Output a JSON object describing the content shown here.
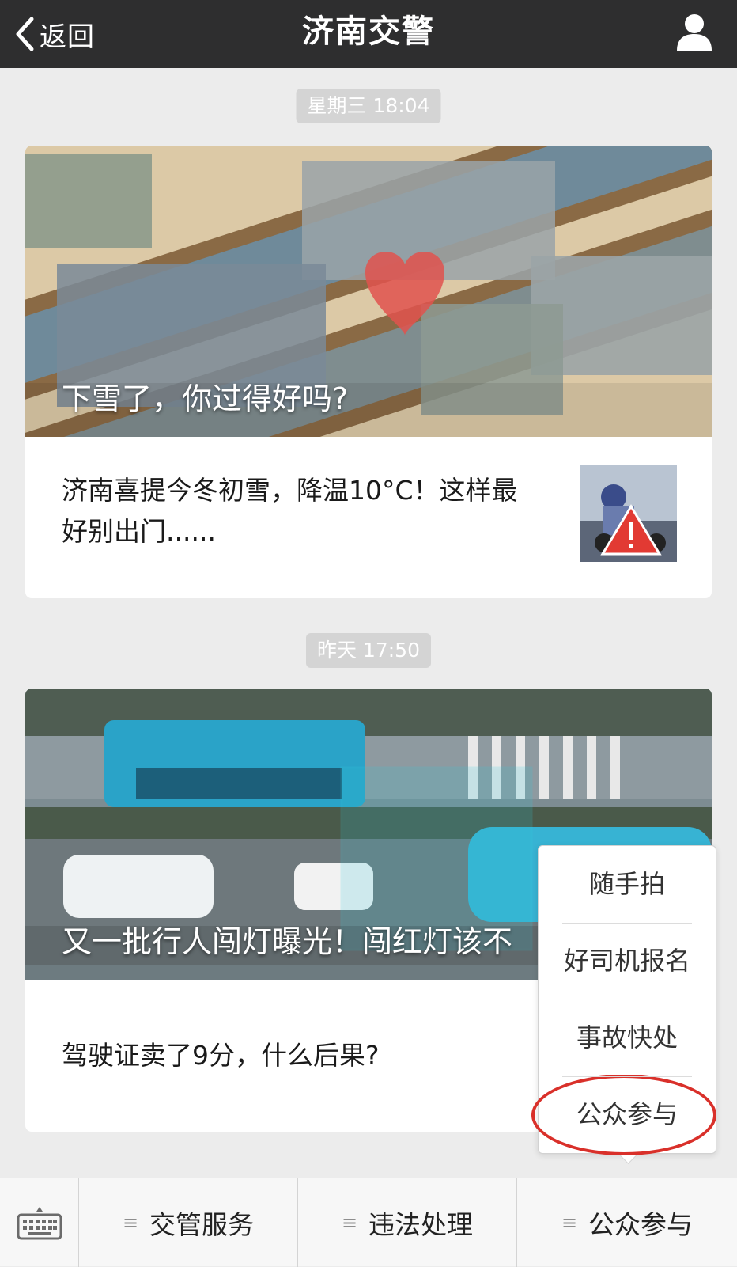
{
  "header": {
    "back_label": "返回",
    "title": "济南交警",
    "icons": {
      "back": "chevron-left-icon",
      "profile": "user-icon"
    }
  },
  "feed": [
    {
      "timestamp": "星期三 18:04",
      "cover_caption": "下雪了，你过得好吗?",
      "sub_title": "济南喜提今冬初雪，降温10°C！这样最好别出门......",
      "thumbnail": "snow-warning-thumbnail"
    },
    {
      "timestamp": "昨天 17:50",
      "cover_caption": "又一批行人闯灯曝光！闯红灯该不",
      "sub_title": "驾驶证卖了9分，什么后果?"
    }
  ],
  "popup_menu": {
    "items": [
      "随手拍",
      "好司机报名",
      "事故快处",
      "公众参与"
    ],
    "highlighted": "公众参与",
    "highlight_color": "#d9302a"
  },
  "bottom_bar": {
    "keyboard_icon": "keyboard-icon",
    "tabs": [
      {
        "label": "交管服务",
        "icon": "menu-icon"
      },
      {
        "label": "违法处理",
        "icon": "menu-icon"
      },
      {
        "label": "公众参与",
        "icon": "menu-icon"
      }
    ]
  },
  "colors": {
    "header_bg": "#2e2e2f",
    "page_bg": "#ececec",
    "timestamp_bg": "#d4d4d4"
  }
}
